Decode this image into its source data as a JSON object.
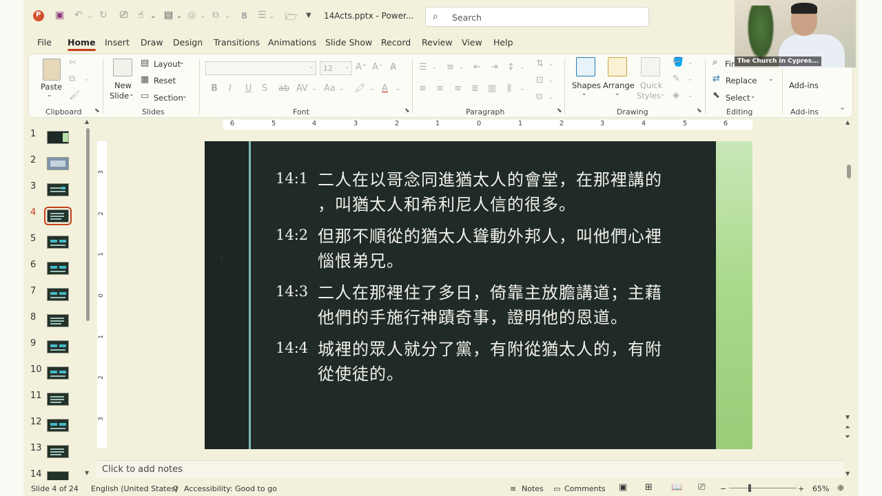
{
  "title_bar": {
    "file_name": "14Acts.pptx",
    "app_name": "Power...",
    "search_placeholder": "Search"
  },
  "tabs": [
    "File",
    "Home",
    "Insert",
    "Draw",
    "Design",
    "Transitions",
    "Animations",
    "Slide Show",
    "Record",
    "Review",
    "View",
    "Help"
  ],
  "active_tab": "Home",
  "ribbon": {
    "clipboard": {
      "paste": "Paste",
      "label": "Clipboard"
    },
    "slides": {
      "new_slide_1": "New",
      "new_slide_2": "Slide",
      "layout": "Layout",
      "reset": "Reset",
      "section": "Section",
      "label": "Slides"
    },
    "font": {
      "size": "12",
      "label": "Font"
    },
    "paragraph": {
      "label": "Paragraph"
    },
    "drawing": {
      "shapes": "Shapes",
      "arrange": "Arrange",
      "quick_styles_1": "Quick",
      "quick_styles_2": "Styles",
      "label": "Drawing"
    },
    "editing": {
      "find": "Fin",
      "replace": "Replace",
      "select": "Select",
      "label": "Editing"
    },
    "addins": {
      "button": "Add-ins",
      "label": "Add-ins"
    }
  },
  "thumbnails": [
    {
      "num": "1"
    },
    {
      "num": "2"
    },
    {
      "num": "3"
    },
    {
      "num": "4",
      "selected": true
    },
    {
      "num": "5"
    },
    {
      "num": "6"
    },
    {
      "num": "7"
    },
    {
      "num": "8"
    },
    {
      "num": "9"
    },
    {
      "num": "10"
    },
    {
      "num": "11"
    },
    {
      "num": "12"
    },
    {
      "num": "13"
    },
    {
      "num": "14"
    }
  ],
  "ruler_h": [
    "6",
    "5",
    "4",
    "3",
    "2",
    "1",
    "0",
    "1",
    "2",
    "3",
    "4",
    "5",
    "6"
  ],
  "ruler_v": [
    "3",
    "2",
    "1",
    "0",
    "1",
    "2",
    "3"
  ],
  "slide": {
    "verses": [
      {
        "ref": "14:1",
        "line1": "二人在以哥念同進猶太人的會堂，在那裡講的",
        "line2": "，叫猶太人和希利尼人信的很多。"
      },
      {
        "ref": "14:2",
        "line1": "但那不順從的猶太人聳動外邦人，叫他們心裡",
        "line2": "惱恨弟兄。"
      },
      {
        "ref": "14:3",
        "line1": "二人在那裡住了多日，倚靠主放膽講道；主藉",
        "line2": "他們的手施行神蹟奇事，證明他的恩道。"
      },
      {
        "ref": "14:4",
        "line1": "城裡的眾人就分了黨，有附從猶太人的，有附",
        "line2": "從使徒的。"
      }
    ]
  },
  "notes_placeholder": "Click to add notes",
  "status": {
    "slide_info": "Slide 4 of 24",
    "language": "English (United States)",
    "accessibility": "Accessibility: Good to go",
    "notes": "Notes",
    "comments": "Comments",
    "zoom": "65%"
  },
  "webcam": {
    "label": "The Church in Cypres..."
  }
}
